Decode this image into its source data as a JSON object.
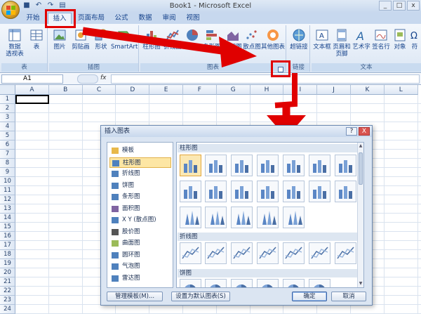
{
  "window": {
    "title": "Book1 - Microsoft Excel"
  },
  "qat": [
    "save-icon",
    "undo-icon",
    "redo-icon",
    "print-preview-icon"
  ],
  "tabs": [
    "开始",
    "插入",
    "页面布局",
    "公式",
    "数据",
    "审阅",
    "视图"
  ],
  "active_tab": "插入",
  "ribbon": {
    "groups": {
      "tables": {
        "label": "表",
        "buttons": [
          "数据\n透视表",
          "表"
        ]
      },
      "illustrations": {
        "label": "插图",
        "buttons": [
          "图片",
          "剪贴画",
          "形状",
          "SmartArt"
        ]
      },
      "charts": {
        "label": "图表",
        "buttons": [
          "柱形图",
          "折线图",
          "饼图",
          "条形图",
          "面积图",
          "散点图",
          "其他图表"
        ]
      },
      "links": {
        "label": "链接",
        "buttons": [
          "超链接"
        ]
      },
      "text": {
        "label": "文本",
        "buttons": [
          "文本框",
          "页眉和\n页脚",
          "艺术字",
          "签名行",
          "对象",
          "符"
        ]
      }
    }
  },
  "formula_bar": {
    "name_box": "A1",
    "fx_label": "fx",
    "value": ""
  },
  "columns": [
    "A",
    "B",
    "C",
    "D",
    "E",
    "F",
    "G",
    "H",
    "I",
    "J",
    "K",
    "L"
  ],
  "rows": [
    "1",
    "2",
    "3",
    "4",
    "5",
    "6",
    "7",
    "8",
    "9",
    "10",
    "11",
    "12",
    "13",
    "14",
    "15",
    "16",
    "17",
    "18",
    "19",
    "20",
    "21",
    "22",
    "23",
    "24"
  ],
  "dialog": {
    "title": "插入图表",
    "help": "?",
    "close": "X",
    "categories": [
      {
        "label": "模板",
        "icon": "folder-icon"
      },
      {
        "label": "柱形图",
        "icon": "column-chart-icon"
      },
      {
        "label": "折线图",
        "icon": "line-chart-icon"
      },
      {
        "label": "饼图",
        "icon": "pie-chart-icon"
      },
      {
        "label": "条形图",
        "icon": "bar-chart-icon"
      },
      {
        "label": "面积图",
        "icon": "area-chart-icon"
      },
      {
        "label": "X Y (散点图)",
        "icon": "scatter-chart-icon"
      },
      {
        "label": "股价图",
        "icon": "stock-chart-icon"
      },
      {
        "label": "曲面图",
        "icon": "surface-chart-icon"
      },
      {
        "label": "圆环图",
        "icon": "doughnut-chart-icon"
      },
      {
        "label": "气泡图",
        "icon": "bubble-chart-icon"
      },
      {
        "label": "雷达图",
        "icon": "radar-chart-icon"
      }
    ],
    "selected_category": "柱形图",
    "sections": [
      "柱形图",
      "折线图",
      "饼图"
    ],
    "buttons": {
      "manage": "管理模板(M)...",
      "set_default": "设置为默认图表(S)",
      "ok": "确定",
      "cancel": "取消"
    }
  },
  "colors": {
    "annotation": "#e00000",
    "ribbon": "#dbe6f4",
    "selection": "#fde6a4"
  }
}
